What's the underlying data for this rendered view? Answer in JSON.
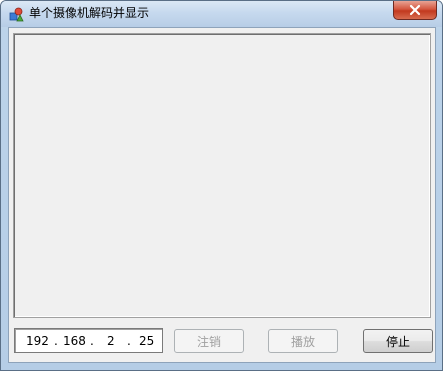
{
  "window": {
    "title": "单个摄像机解码并显示",
    "app_icon": "app-icon",
    "close_icon": "close-icon",
    "close_color": "#c7402a"
  },
  "ip_address": {
    "octet1": "192",
    "octet2": "168",
    "octet3": "2",
    "octet4": "25",
    "dot": "."
  },
  "buttons": {
    "logout_label": "注销",
    "play_label": "播放",
    "stop_label": "停止"
  },
  "state": {
    "logout_enabled": false,
    "play_enabled": false,
    "stop_enabled": true
  }
}
